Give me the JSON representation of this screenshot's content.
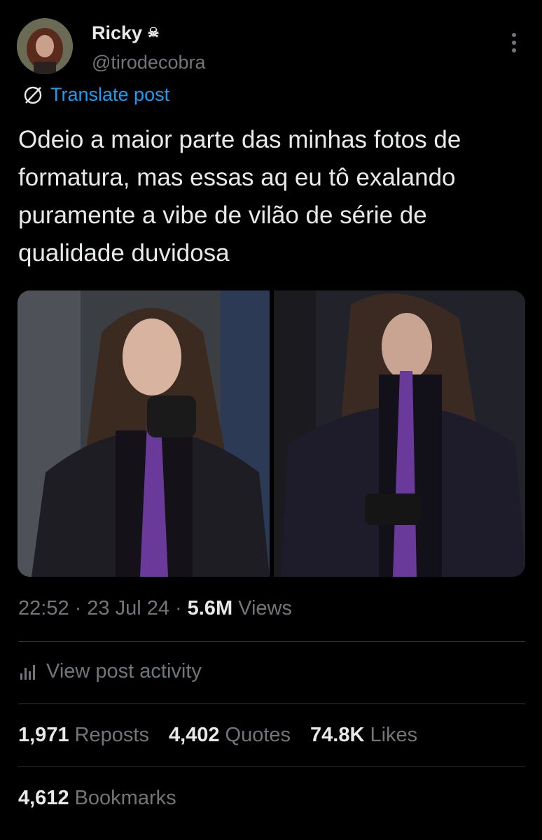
{
  "author": {
    "display_name": "Ricky",
    "badge": "☠",
    "handle": "@tirodecobra"
  },
  "icons": {
    "badge": "skull-crossbones-icon",
    "more": "more-vertical-icon",
    "translate": "globe-icon",
    "activity": "bar-chart-icon"
  },
  "translate_label": "Translate post",
  "post_text": "Odeio a maior parte das minhas fotos de formatura, mas essas aq eu tô exalando puramente a vibe de vilão de série de qualidade duvidosa",
  "meta": {
    "time": "22:52",
    "separator": "·",
    "date": "23 Jul 24",
    "views_count": "5.6M",
    "views_label": "Views"
  },
  "activity_label": "View post activity",
  "stats": [
    {
      "count": "1,971",
      "label": "Reposts"
    },
    {
      "count": "4,402",
      "label": "Quotes"
    },
    {
      "count": "74.8K",
      "label": "Likes"
    }
  ],
  "bookmarks": {
    "count": "4,612",
    "label": "Bookmarks"
  },
  "colors": {
    "background": "#000000",
    "text": "#e7e9ea",
    "secondary_text": "#71767b",
    "link": "#1d9bf0",
    "divider": "#2f3336"
  }
}
